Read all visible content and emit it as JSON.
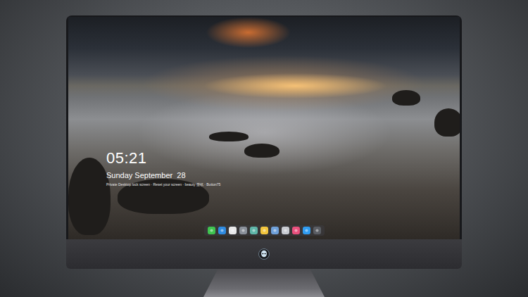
{
  "screen": {
    "clock": {
      "time": "05:21",
      "date": "Sunday September  28",
      "notice": "Private Desktop lock screen · Reset your screen · beauty 壁纸 · Button75"
    }
  },
  "dock": {
    "items": [
      {
        "color": "#3fc34f"
      },
      {
        "color": "#2f8be0"
      },
      {
        "color": "#e8e8e8"
      },
      {
        "color": "#8a9099"
      },
      {
        "color": "#5fb6a8"
      },
      {
        "color": "#f2c53d"
      },
      {
        "color": "#6fa0d8"
      },
      {
        "color": "#c9cbd0"
      },
      {
        "color": "#e9507c"
      },
      {
        "color": "#2f9cf0"
      },
      {
        "color": "#5a5d63"
      }
    ]
  }
}
